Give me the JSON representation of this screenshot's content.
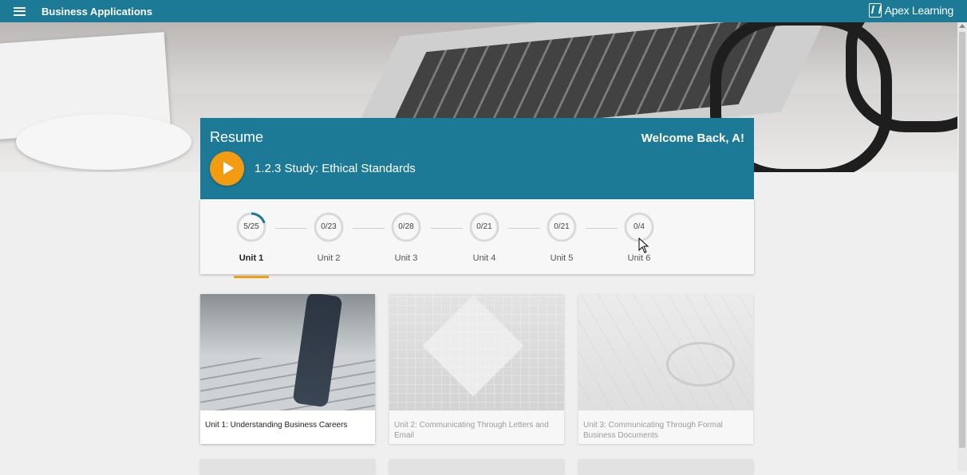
{
  "header": {
    "menu_icon": "hamburger-menu-icon",
    "app_title": "Business Applications",
    "logo_text": "Apex Learning",
    "background_color": "#1c7a96"
  },
  "resume": {
    "title": "Resume",
    "welcome": "Welcome Back, A!",
    "current_activity": "1.2.3 Study: Ethical Standards",
    "play_icon": "play-icon",
    "accent_color": "#f39c12"
  },
  "units": [
    {
      "label": "Unit 1",
      "progress": "5/25",
      "completed": 5,
      "total": 25,
      "active": true
    },
    {
      "label": "Unit 2",
      "progress": "0/23",
      "completed": 0,
      "total": 23,
      "active": false
    },
    {
      "label": "Unit 3",
      "progress": "0/28",
      "completed": 0,
      "total": 28,
      "active": false
    },
    {
      "label": "Unit 4",
      "progress": "0/21",
      "completed": 0,
      "total": 21,
      "active": false
    },
    {
      "label": "Unit 5",
      "progress": "0/21",
      "completed": 0,
      "total": 21,
      "active": false
    },
    {
      "label": "Unit 6",
      "progress": "0/4",
      "completed": 0,
      "total": 4,
      "active": false
    }
  ],
  "cards": [
    {
      "title": "Unit 1: Understanding Business Careers"
    },
    {
      "title": "Unit 2: Communicating Through Letters and Email"
    },
    {
      "title": "Unit 3: Communicating Through Formal Business Documents"
    }
  ]
}
